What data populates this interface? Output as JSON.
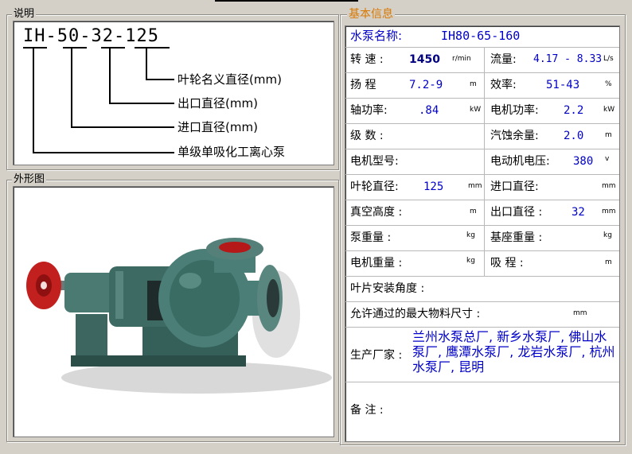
{
  "explain": {
    "legend": "说明",
    "model_code": "IH-50-32-125",
    "annotations": [
      "叶轮名义直径(mm)",
      "出口直径(mm)",
      "进口直径(mm)",
      "单级单吸化工离心泵"
    ]
  },
  "outline": {
    "legend": "外形图"
  },
  "info": {
    "legend": "基本信息",
    "pump_name_label": "水泵名称:",
    "pump_name_value": "IH80-65-160",
    "rows": [
      {
        "l_label": "转 速 :",
        "l_value": "1450",
        "l_unit": "r/min",
        "r_label": "流量:",
        "r_value": "4.17 - 8.33",
        "r_unit": "L/s"
      },
      {
        "l_label": "扬 程",
        "l_value": "7.2-9",
        "l_unit": "m",
        "r_label": "效率:",
        "r_value": "51-43",
        "r_unit": "%"
      },
      {
        "l_label": "轴功率:",
        "l_value": ".84",
        "l_unit": "kW",
        "r_label": "电机功率:",
        "r_value": "2.2",
        "r_unit": "kW"
      },
      {
        "l_label": "级 数 :",
        "l_value": "",
        "l_unit": "",
        "r_label": "汽蚀余量:",
        "r_value": "2.0",
        "r_unit": "m"
      },
      {
        "l_label": "电机型号:",
        "l_value": "",
        "l_unit": "",
        "r_label": "电动机电压:",
        "r_value": "380",
        "r_unit": "v"
      },
      {
        "l_label": "叶轮直径:",
        "l_value": "125",
        "l_unit": "mm",
        "r_label": "进口直径:",
        "r_value": "",
        "r_unit": "mm"
      },
      {
        "l_label": "真空高度 :",
        "l_value": "",
        "l_unit": "m",
        "r_label": "出口直径 :",
        "r_value": "32",
        "r_unit": "mm"
      },
      {
        "l_label": "泵重量 :",
        "l_value": "",
        "l_unit": "kg",
        "r_label": "基座重量 :",
        "r_value": "",
        "r_unit": "kg"
      },
      {
        "l_label": "电机重量 :",
        "l_value": "",
        "l_unit": "kg",
        "r_label": "吸 程 :",
        "r_value": "",
        "r_unit": "m"
      }
    ],
    "vane_angle_label": "叶片安装角度 :",
    "max_particle_label": "允许通过的最大物料尺寸 :",
    "max_particle_unit": "mm",
    "maker_label": "生产厂家 :",
    "maker_value": "兰州水泵总厂, 新乡水泵厂, 佛山水泵厂, 鹰潭水泵厂, 龙岩水泵厂, 杭州水泵厂, 昆明",
    "remark_label": "备 注 :"
  }
}
